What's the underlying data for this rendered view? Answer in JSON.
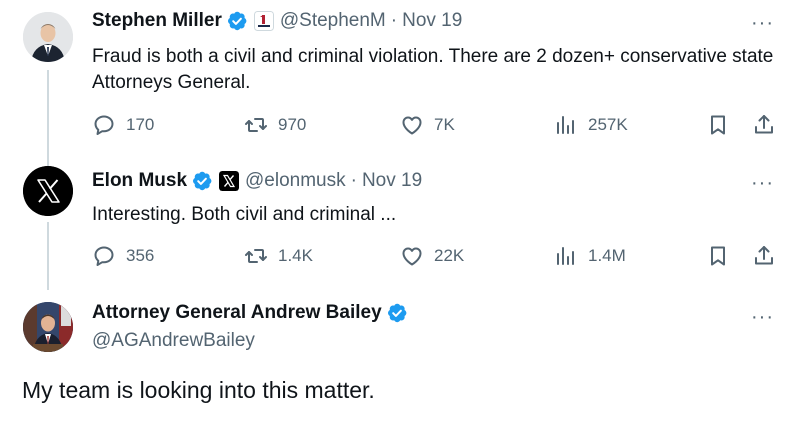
{
  "tweets": [
    {
      "name": "Stephen Miller",
      "handle": "@StephenM",
      "date": "Nov 19",
      "text": "Fraud is both a civil and criminal violation. There are 2 dozen+ conservative state Attorneys General.",
      "replies": "170",
      "retweets": "970",
      "likes": "7K",
      "views": "257K",
      "more": "···"
    },
    {
      "name": "Elon Musk",
      "handle": "@elonmusk",
      "date": "Nov 19",
      "text": "Interesting. Both civil and criminal ...",
      "replies": "356",
      "retweets": "1.4K",
      "likes": "22K",
      "views": "1.4M",
      "more": "···"
    }
  ],
  "main": {
    "name": "Attorney General Andrew Bailey",
    "handle": "@AGAndrewBailey",
    "text": "My team is looking into this matter.",
    "more": "···"
  },
  "separator": "·",
  "colors": {
    "verified": "#1d9bf0",
    "muted": "#536471",
    "thread_line": "#cfd9de"
  }
}
